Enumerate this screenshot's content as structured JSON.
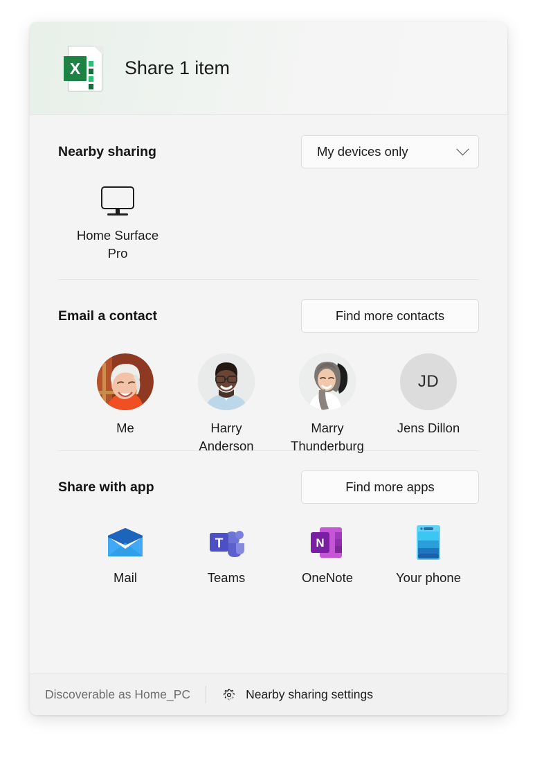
{
  "header": {
    "title": "Share 1 item",
    "file_icon": "excel-file-icon",
    "file_letter": "X",
    "accent_color": "#1e8245"
  },
  "nearby": {
    "title": "Nearby sharing",
    "dropdown": {
      "value": "My devices only",
      "icon": "chevron-down-icon"
    },
    "devices": [
      {
        "name": "Home Surface Pro",
        "icon": "monitor-icon"
      }
    ]
  },
  "contacts": {
    "title": "Email a contact",
    "find_more_label": "Find more contacts",
    "items": [
      {
        "name": "Me",
        "avatar": "photo-avatar-me",
        "initials": ""
      },
      {
        "name": "Harry Anderson",
        "avatar": "photo-avatar-harry",
        "initials": ""
      },
      {
        "name": "Marry Thunderburg",
        "avatar": "photo-avatar-marry",
        "initials": ""
      },
      {
        "name": "Jens Dillon",
        "avatar": "initials-avatar",
        "initials": "JD"
      }
    ]
  },
  "apps": {
    "title": "Share with app",
    "find_more_label": "Find more apps",
    "items": [
      {
        "name": "Mail",
        "icon": "mail-icon"
      },
      {
        "name": "Teams",
        "icon": "teams-icon"
      },
      {
        "name": "OneNote",
        "icon": "onenote-icon"
      },
      {
        "name": "Your phone",
        "icon": "phone-icon"
      }
    ]
  },
  "footer": {
    "status": "Discoverable as Home_PC",
    "settings_icon": "gear-icon",
    "settings_label": "Nearby sharing settings"
  }
}
